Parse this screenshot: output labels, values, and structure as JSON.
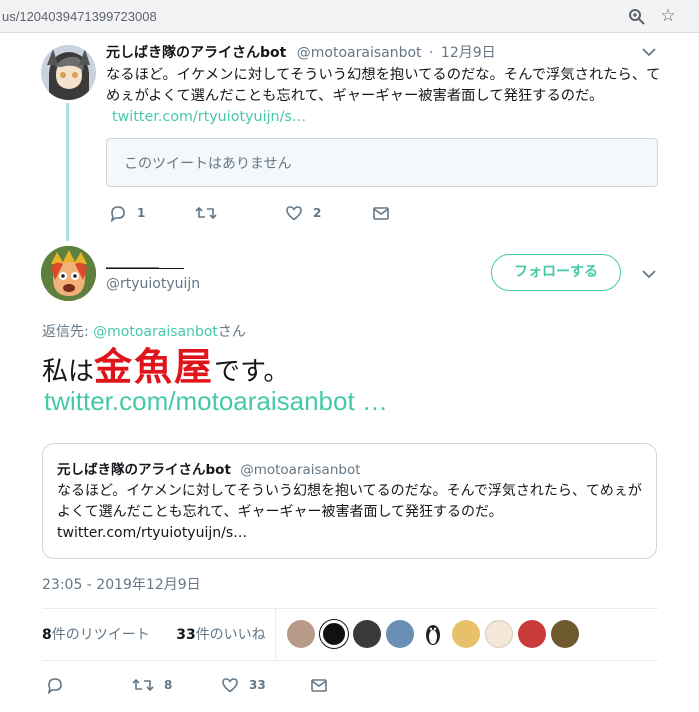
{
  "browser": {
    "url": "us/1204039471399723008"
  },
  "tweet1": {
    "name": "元しばき隊のアライさんbot",
    "handle": "@motoaraisanbot",
    "dot": "·",
    "date": "12月9日",
    "body": "なるほど。イケメンに対してそういう幻想を抱いてるのだな。そんで浮気されたら、てめぇがよくて選んだことも忘れて、ギャーギャー被害者面して発狂するのだ。",
    "link": "twitter.com/rtyuiotyuijn/s…",
    "unavailable": "このツイートはありません",
    "reply_count": "1",
    "like_count": "2"
  },
  "tweet2": {
    "name": "＿＿＿＿＿",
    "handle": "@rtyuiotyuijn",
    "follow_label": "フォローする",
    "reply_prefix": "返信先: ",
    "reply_handle": "@motoaraisanbot",
    "reply_suffix": "さん",
    "text_before": "私は",
    "text_red": "金魚屋",
    "text_after": "です。",
    "link": "twitter.com/motoaraisanbot …",
    "quote": {
      "name": "元しばき隊のアライさんbot",
      "handle": "@motoaraisanbot",
      "body": "なるほど。イケメンに対してそういう幻想を抱いてるのだな。そんで浮気されたら、てめぇがよくて選んだことも忘れて、ギャーギャー被害者面して発狂するのだ。",
      "link": "twitter.com/rtyuiotyuijn/s…"
    },
    "timestamp": "23:05 - 2019年12月9日",
    "retweets_num": "8",
    "retweets_label": "件のリツイート",
    "likes_num": "33",
    "likes_label": "件のいいね",
    "retweet_count": "8",
    "like_count": "33"
  },
  "colors": {
    "accent": "#45c9a8",
    "red_text": "#e0151b",
    "muted": "#657786"
  }
}
